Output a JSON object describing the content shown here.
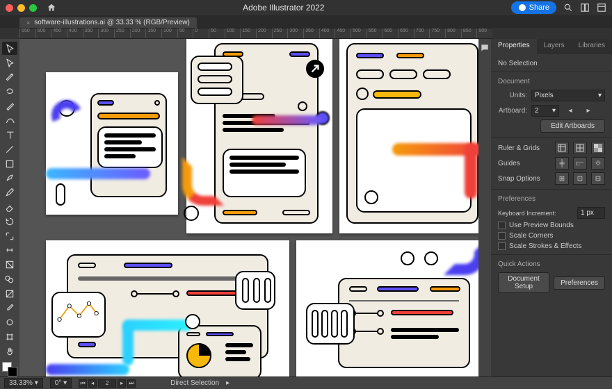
{
  "app": {
    "title": "Adobe Illustrator 2022"
  },
  "share": {
    "label": "Share"
  },
  "doc": {
    "tab_label": "software-illustrations.ai @ 33.33 % (RGB/Preview)"
  },
  "ruler_ticks": [
    "550",
    "500",
    "450",
    "400",
    "350",
    "300",
    "250",
    "200",
    "150",
    "100",
    "50",
    "0",
    "50",
    "100",
    "150",
    "200",
    "250",
    "300",
    "350",
    "400",
    "450",
    "500",
    "550",
    "600",
    "650",
    "700",
    "750",
    "800",
    "850",
    "900"
  ],
  "panel": {
    "tabs": [
      "Properties",
      "Layers",
      "Libraries"
    ],
    "no_selection": "No Selection",
    "document_heading": "Document",
    "units_label": "Units:",
    "units_value": "Pixels",
    "artboard_label": "Artboard:",
    "artboard_value": "2",
    "edit_artboards": "Edit Artboards",
    "ruler_grids": "Ruler & Grids",
    "guides": "Guides",
    "snap_options": "Snap Options",
    "preferences_heading": "Preferences",
    "kb_increment_label": "Keyboard Increment:",
    "kb_increment_value": "1 px",
    "use_preview_bounds": "Use Preview Bounds",
    "scale_corners": "Scale Corners",
    "scale_strokes": "Scale Strokes & Effects",
    "quick_actions": "Quick Actions",
    "doc_setup": "Document Setup",
    "prefs_btn": "Preferences"
  },
  "status": {
    "zoom": "33.33%",
    "rotate": "0°",
    "artboard_nav": "2",
    "tool": "Direct Selection"
  },
  "tools": [
    "selection",
    "direct-selection",
    "magic-wand",
    "lasso",
    "pen",
    "curvature",
    "type",
    "line",
    "rectangle",
    "paintbrush",
    "pencil",
    "eraser",
    "rotate",
    "scale",
    "width",
    "free-transform",
    "shape-builder",
    "gradient",
    "eyedropper",
    "blend",
    "artboard",
    "hand"
  ]
}
